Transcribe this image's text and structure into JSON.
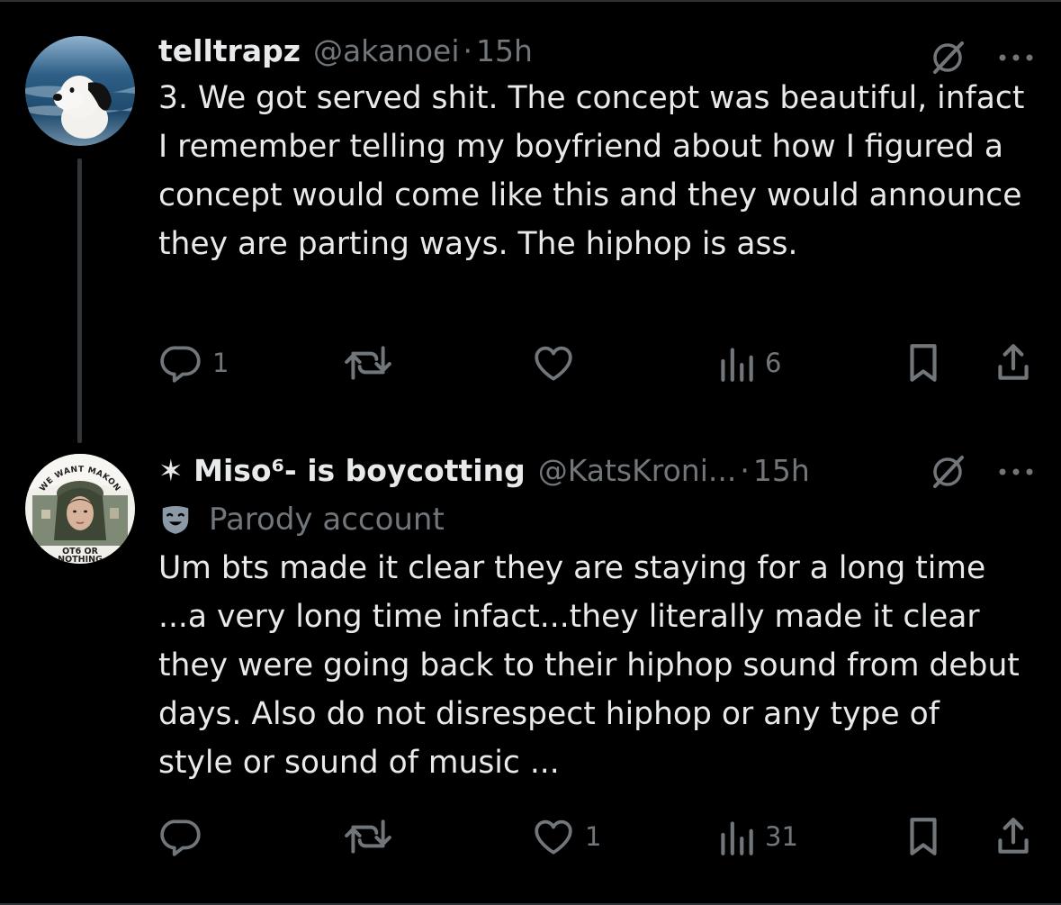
{
  "colors": {
    "background": "#000000",
    "text_primary": "#e7e9ea",
    "text_secondary": "#71767b",
    "divider": "#2f3336"
  },
  "tweets": [
    {
      "display_name": "telltrapz",
      "handle": "@akanoei",
      "separator": "·",
      "time": "15h",
      "text": "3. We got served shit. The concept was beautiful, infact I remember telling my boyfriend about how I figured a concept would come like this and they would announce they are parting ways. The hiphop is ass.",
      "avatar": "snoopy-plush-avatar",
      "stats": {
        "replies": "1",
        "reposts": "",
        "likes": "",
        "views": "6"
      }
    },
    {
      "display_name": "✶ Miso⁶- is boycotting",
      "handle": "@KatsKroni...",
      "separator": "·",
      "time": "15h",
      "label": "Parody account",
      "avatar_texts": {
        "top": "WE WANT MAKON",
        "bottom1": "OT6 OR",
        "bottom2": "NOTHING"
      },
      "text": "Um bts made it clear they are staying for a long time ...a very long time infact...they literally made it clear they were going back to their hiphop sound from debut days. Also do not disrespect hiphop or any type of style or sound of music ...",
      "stats": {
        "replies": "",
        "reposts": "",
        "likes": "1",
        "views": "31"
      }
    }
  ],
  "icons": [
    "reply-icon",
    "repost-icon",
    "like-icon",
    "views-icon",
    "bookmark-icon",
    "share-icon",
    "grok-icon",
    "more-icon",
    "parody-mask-icon"
  ]
}
